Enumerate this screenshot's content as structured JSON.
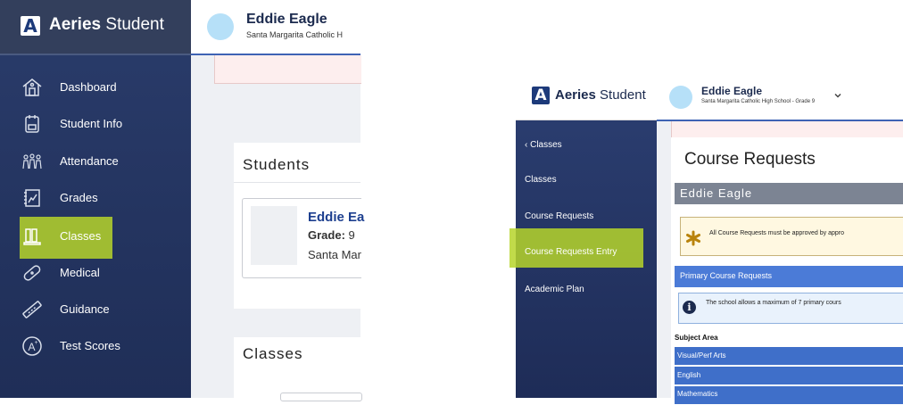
{
  "left_panel": {
    "brand": {
      "bold": "Aeries",
      "light": "Student",
      "logo_letter": "A"
    },
    "nav": [
      {
        "label": "Dashboard",
        "icon": "home-icon"
      },
      {
        "label": "Student Info",
        "icon": "student-info-icon"
      },
      {
        "label": "Attendance",
        "icon": "attendance-icon"
      },
      {
        "label": "Grades",
        "icon": "grades-icon"
      },
      {
        "label": "Classes",
        "icon": "classes-icon",
        "highlighted": true
      },
      {
        "label": "Medical",
        "icon": "medical-icon"
      },
      {
        "label": "Guidance",
        "icon": "guidance-icon"
      },
      {
        "label": "Test Scores",
        "icon": "test-scores-icon"
      }
    ],
    "header": {
      "name": "Eddie Eagle",
      "school": "Santa Margarita Catholic H"
    },
    "students_card": {
      "title": "Students",
      "student_name": "Eddie Ea",
      "grade_label": "Grade:",
      "grade_value": "9",
      "school": "Santa Mar"
    },
    "classes_card": {
      "title": "Classes"
    }
  },
  "right_panel": {
    "brand": {
      "bold": "Aeries",
      "light": "Student",
      "logo_letter": "A"
    },
    "header": {
      "name": "Eddie Eagle",
      "school": "Santa Margarita Catholic High School - Grade 9"
    },
    "nav": {
      "back": "‹ Classes",
      "items": [
        "Classes",
        "Course Requests",
        "Course Requests Entry",
        "Academic Plan"
      ],
      "highlighted": "Course Requests Entry"
    },
    "page_title": "Course Requests",
    "student_bar": "Eddie Eagle",
    "warning": "All Course Requests must be approved by appro",
    "primary_bar": "Primary Course Requests",
    "info": "The school allows a maximum of 7 primary cours",
    "subject_header": "Subject Area",
    "subjects": [
      "Visual/Perf Arts",
      "English",
      "Mathematics"
    ]
  },
  "colors": {
    "sidebar": "#2a3c6b",
    "highlight": "#b6d52a",
    "accent_blue": "#3e63b4",
    "primary_bar": "#4b7bd7"
  }
}
